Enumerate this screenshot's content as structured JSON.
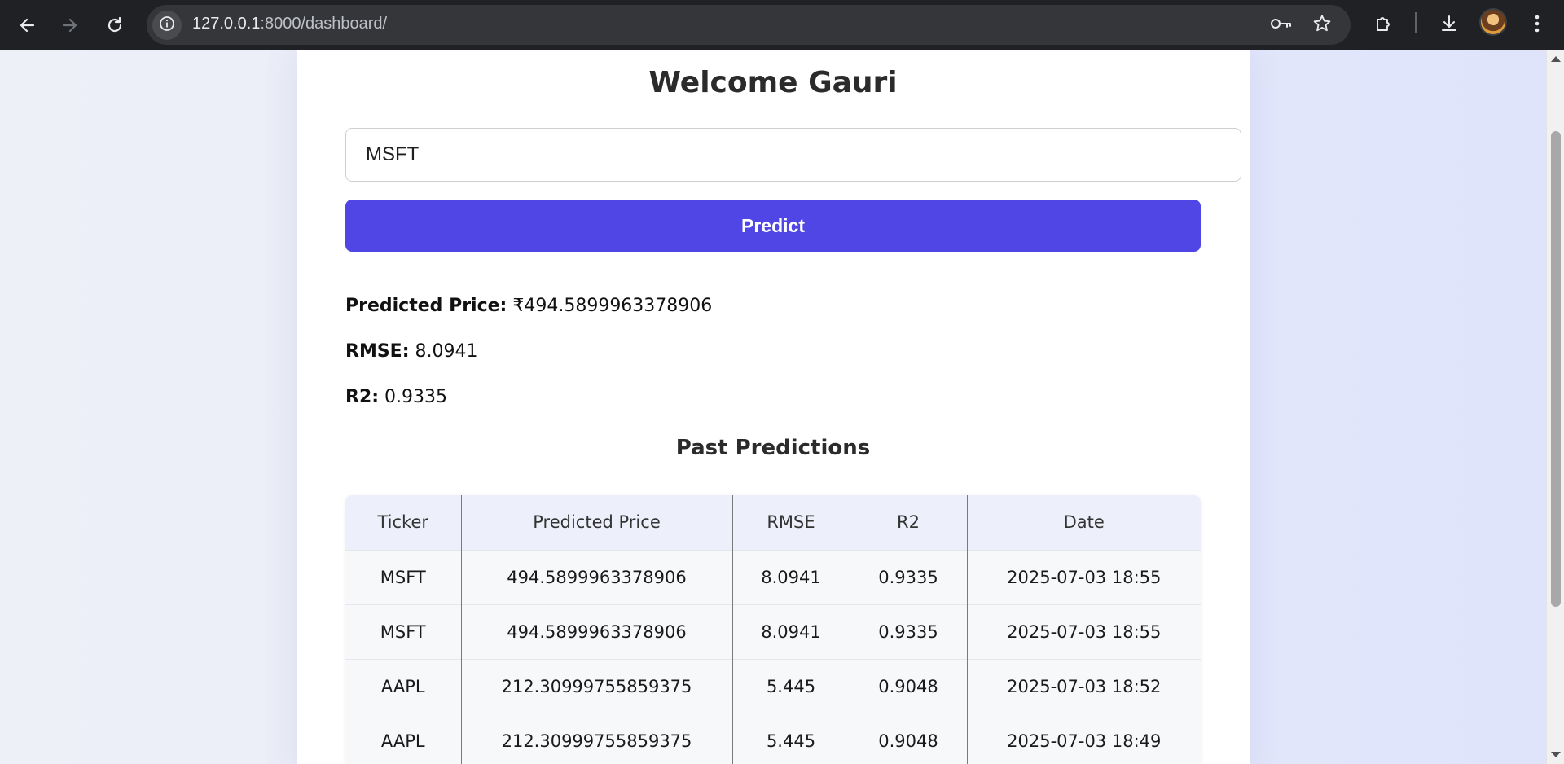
{
  "browser": {
    "url_host": "127.0.0.1",
    "url_rest": ":8000/dashboard/",
    "icons": {
      "back": "back-arrow-icon",
      "forward": "forward-arrow-icon",
      "reload": "reload-icon",
      "site_info": "info-icon",
      "password": "key-icon",
      "bookmark": "star-icon",
      "extensions": "puzzle-icon",
      "downloads": "download-icon",
      "profile": "avatar",
      "menu": "kebab-menu-icon"
    }
  },
  "page": {
    "welcome": "Welcome Gauri",
    "ticker_value": "MSFT",
    "predict_label": "Predict",
    "metrics": [
      {
        "label": "Predicted Price:",
        "value": "₹494.5899963378906"
      },
      {
        "label": "RMSE:",
        "value": "8.0941"
      },
      {
        "label": "R2:",
        "value": "0.9335"
      }
    ],
    "past_title": "Past Predictions",
    "table": {
      "headers": [
        "Ticker",
        "Predicted Price",
        "RMSE",
        "R2",
        "Date"
      ],
      "rows": [
        [
          "MSFT",
          "494.5899963378906",
          "8.0941",
          "0.9335",
          "2025-07-03 18:55"
        ],
        [
          "MSFT",
          "494.5899963378906",
          "8.0941",
          "0.9335",
          "2025-07-03 18:55"
        ],
        [
          "AAPL",
          "212.30999755859375",
          "5.445",
          "0.9048",
          "2025-07-03 18:52"
        ],
        [
          "AAPL",
          "212.30999755859375",
          "5.445",
          "0.9048",
          "2025-07-03 18:49"
        ]
      ]
    }
  },
  "colors": {
    "chrome_bg": "#202124",
    "omnibox_bg": "#35363a",
    "accent": "#4f46e5",
    "table_header_bg": "#edf0fb",
    "table_row_bg": "#f7f8fa"
  }
}
